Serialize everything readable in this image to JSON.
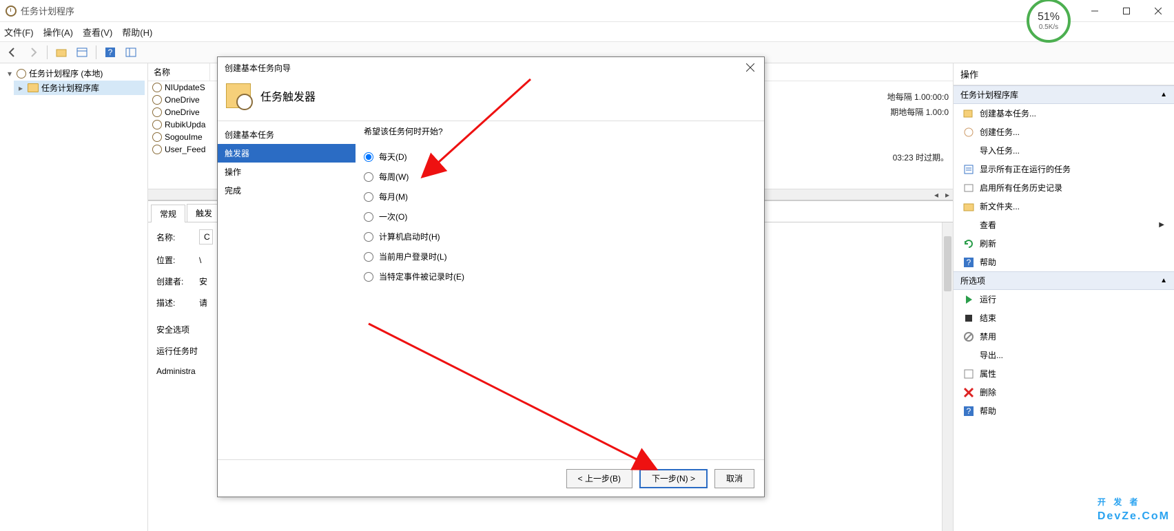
{
  "window": {
    "title": "任务计划程序"
  },
  "speed": {
    "percent": "51%",
    "rate": "0.5K/s"
  },
  "menu": {
    "file": "文件(F)",
    "action": "操作(A)",
    "view": "查看(V)",
    "help": "帮助(H)"
  },
  "tree": {
    "root": "任务计划程序 (本地)",
    "library": "任务计划程序库"
  },
  "tasks": {
    "col_name": "名称",
    "rows": [
      "NIUpdateS",
      "OneDrive",
      "OneDrive",
      "RubikUpda",
      "SogouIme",
      "User_Feed"
    ],
    "rightTexts": [
      "",
      "地每隔 1.00:00:0",
      "期地每隔 1.00:0",
      "",
      "",
      "03:23 时过期。"
    ]
  },
  "tabs": {
    "general": "常规",
    "trigger": "触发"
  },
  "detail": {
    "name_label": "名称:",
    "name_prefix": "C",
    "location_label": "位置:",
    "location_val": "\\",
    "creator_label": "创建者:",
    "creator_val": "安",
    "desc_label": "描述:",
    "desc_prefix": "请",
    "security_label": "安全选项",
    "runas_label": "运行任务时",
    "admin": "Administra"
  },
  "actions": {
    "header": "操作",
    "section1": "任务计划程序库",
    "items1": [
      "创建基本任务...",
      "创建任务...",
      "导入任务...",
      "显示所有正在运行的任务",
      "启用所有任务历史记录",
      "新文件夹...",
      "查看",
      "刷新",
      "帮助"
    ],
    "section2": "所选项",
    "items2": [
      "运行",
      "结束",
      "禁用",
      "导出...",
      "属性",
      "删除",
      "帮助"
    ]
  },
  "wizard": {
    "title": "创建基本任务向导",
    "heading": "任务触发器",
    "nav": [
      "创建基本任务",
      "触发器",
      "操作",
      "完成"
    ],
    "question": "希望该任务何时开始?",
    "options": [
      "每天(D)",
      "每周(W)",
      "每月(M)",
      "一次(O)",
      "计算机启动时(H)",
      "当前用户登录时(L)",
      "当特定事件被记录时(E)"
    ],
    "back": "< 上一步(B)",
    "next": "下一步(N) >",
    "cancel": "取消"
  },
  "watermark": {
    "top": "开 发 者",
    "sub": "DevZe.CoM"
  }
}
